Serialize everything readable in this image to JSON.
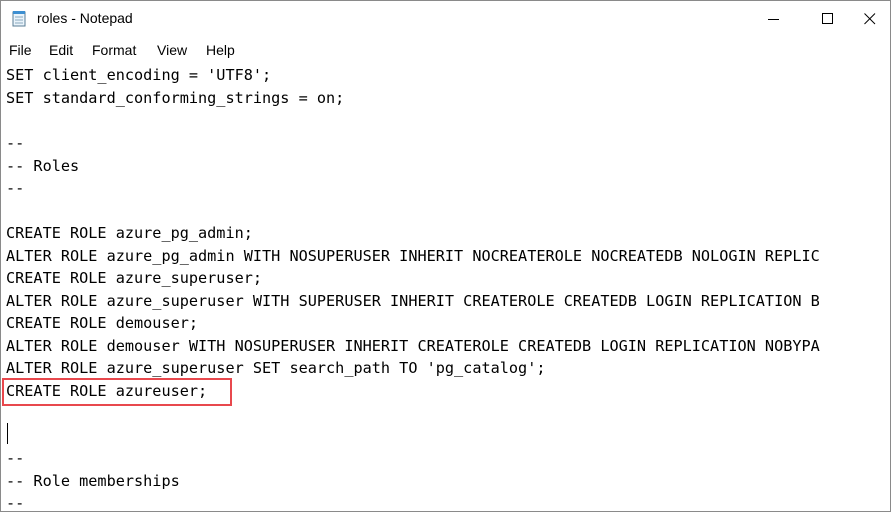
{
  "window": {
    "title": "roles - Notepad",
    "app_icon": "notepad-icon",
    "controls": [
      "minimize-icon",
      "maximize-icon",
      "close-icon"
    ]
  },
  "menu": {
    "file": "File",
    "edit": "Edit",
    "format": "Format",
    "view": "View",
    "help": "Help"
  },
  "editor": {
    "lines": [
      "SET client_encoding = 'UTF8';",
      "SET standard_conforming_strings = on;",
      "",
      "--",
      "-- Roles",
      "--",
      "",
      "CREATE ROLE azure_pg_admin;",
      "ALTER ROLE azure_pg_admin WITH NOSUPERUSER INHERIT NOCREATEROLE NOCREATEDB NOLOGIN REPLIC",
      "CREATE ROLE azure_superuser;",
      "ALTER ROLE azure_superuser WITH SUPERUSER INHERIT CREATEROLE CREATEDB LOGIN REPLICATION B",
      "CREATE ROLE demouser;",
      "ALTER ROLE demouser WITH NOSUPERUSER INHERIT CREATEROLE CREATEDB LOGIN REPLICATION NOBYPA",
      "ALTER ROLE azure_superuser SET search_path TO 'pg_catalog';",
      "CREATE ROLE azureuser;",
      "",
      "",
      "--",
      "-- Role memberships",
      "--"
    ],
    "highlight_color": "#e8484d"
  }
}
